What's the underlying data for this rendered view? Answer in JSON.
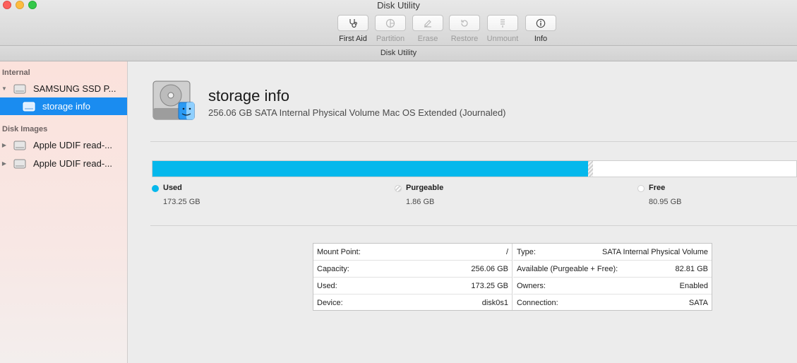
{
  "window": {
    "title": "Disk Utility"
  },
  "toolbar": {
    "first_aid": "First Aid",
    "partition": "Partition",
    "erase": "Erase",
    "restore": "Restore",
    "unmount": "Unmount",
    "info": "Info"
  },
  "tab": {
    "title": "Disk Utility"
  },
  "sidebar": {
    "internal_header": "Internal",
    "disk_images_header": "Disk Images",
    "items": [
      {
        "label": "SAMSUNG SSD P..."
      },
      {
        "label": "storage info"
      },
      {
        "label": "Apple UDIF read-..."
      },
      {
        "label": "Apple UDIF read-..."
      }
    ]
  },
  "volume": {
    "name": "storage info",
    "description": "256.06 GB SATA Internal Physical Volume Mac OS Extended (Journaled)"
  },
  "usage": {
    "used_fraction": 0.6766,
    "purgeable_fraction": 0.0073,
    "used_label": "Used",
    "used_value": "173.25 GB",
    "purgeable_label": "Purgeable",
    "purgeable_value": "1.86 GB",
    "free_label": "Free",
    "free_value": "80.95 GB",
    "colors": {
      "used": "#05b8ec",
      "free": "#ffffff"
    }
  },
  "info_table": {
    "left": [
      {
        "key": "Mount Point:",
        "value": "/"
      },
      {
        "key": "Capacity:",
        "value": "256.06 GB"
      },
      {
        "key": "Used:",
        "value": "173.25 GB"
      },
      {
        "key": "Device:",
        "value": "disk0s1"
      }
    ],
    "right": [
      {
        "key": "Type:",
        "value": "SATA Internal Physical Volume"
      },
      {
        "key": "Available (Purgeable + Free):",
        "value": "82.81 GB"
      },
      {
        "key": "Owners:",
        "value": "Enabled"
      },
      {
        "key": "Connection:",
        "value": "SATA"
      }
    ]
  }
}
